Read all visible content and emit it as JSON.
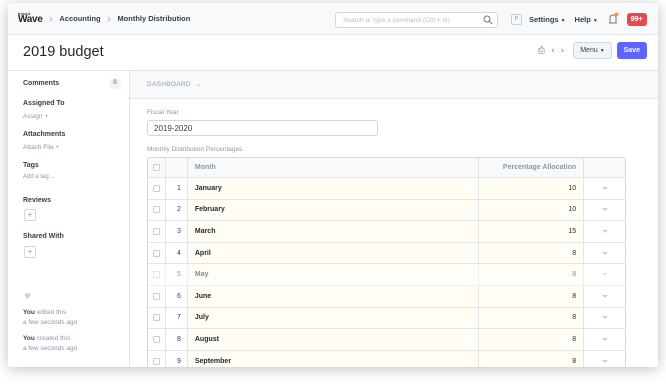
{
  "navbar": {
    "brand_top": "brand",
    "brand_main": "Wave",
    "breadcrumbs": [
      "Accounting",
      "Monthly Distribution"
    ],
    "search_placeholder": "Search or type a command (Ctrl + G)",
    "user_initial": "P",
    "settings_label": "Settings",
    "help_label": "Help",
    "notification_count": "99+"
  },
  "page": {
    "title": "2019 budget",
    "menu_label": "Menu",
    "save_label": "Save"
  },
  "sidebar": {
    "comments_label": "Comments",
    "comments_count": "0",
    "assigned_to_label": "Assigned To",
    "assign_link": "Assign +",
    "attachments_label": "Attachments",
    "attach_link": "Attach File +",
    "tags_label": "Tags",
    "add_tag_link": "Add a tag ...",
    "reviews_label": "Reviews",
    "shared_with_label": "Shared With",
    "activity": [
      {
        "who": "You",
        "what": " edited this",
        "when": "a few seconds ago"
      },
      {
        "who": "You",
        "what": " created this",
        "when": "a few seconds ago"
      }
    ]
  },
  "main": {
    "dashboard_label": "DASHBOARD",
    "fiscal_year_label": "Fiscal Year",
    "fiscal_year_value": "2019-2020",
    "table_label": "Monthly Distribution Percentages",
    "columns": {
      "month": "Month",
      "percentage": "Percentage Allocation"
    },
    "rows": [
      {
        "idx": "1",
        "month": "January",
        "pct": "10"
      },
      {
        "idx": "2",
        "month": "February",
        "pct": "10"
      },
      {
        "idx": "3",
        "month": "March",
        "pct": "15"
      },
      {
        "idx": "4",
        "month": "April",
        "pct": "8"
      },
      {
        "idx": "5",
        "month": "May",
        "pct": "8"
      },
      {
        "idx": "6",
        "month": "June",
        "pct": "8"
      },
      {
        "idx": "7",
        "month": "July",
        "pct": "8"
      },
      {
        "idx": "8",
        "month": "August",
        "pct": "8"
      },
      {
        "idx": "9",
        "month": "September",
        "pct": "8"
      }
    ]
  },
  "colors": {
    "primary": "#5e64ff",
    "badge": "#e24c4c"
  }
}
